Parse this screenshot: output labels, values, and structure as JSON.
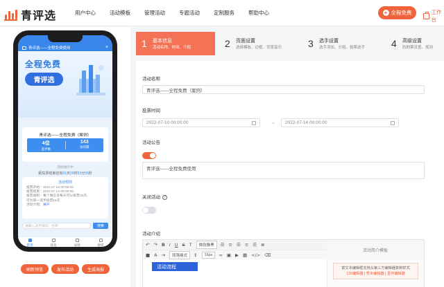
{
  "brand": {
    "name": "青评选",
    "accent": "#f0643c"
  },
  "nav": {
    "items": [
      "用户中心",
      "活动模板",
      "管理活动",
      "专题活动",
      "定制服务",
      "帮助中心"
    ]
  },
  "header": {
    "free_button": "全程免费",
    "workbench": "工作台"
  },
  "phone": {
    "announcement": "青评选——全程免费使用",
    "banner_line1": "全程免费",
    "banner_line2": "青评选",
    "activity_title": "青评选——全程免费（案例）",
    "stats": [
      {
        "value": "4位",
        "label": "选手数"
      },
      {
        "value": "143",
        "label": "访问量"
      }
    ],
    "progress_label": "活动进行中",
    "progress_prefix": "距投票结束还有",
    "countdown": [
      {
        "num": "01",
        "unit": "天"
      },
      {
        "num": "09",
        "unit": "时"
      },
      {
        "num": "53",
        "unit": "分"
      },
      {
        "num": "55",
        "unit": "秒"
      }
    ],
    "rules_title": "活动规则",
    "rules": [
      "投票开始：2022.07.10 00:00:00",
      "投票结束：2022.07.14 00:00:00",
      "投票规则：每个微信号每天可以投票15次,",
      "可为同一选手投票15次"
    ],
    "intro_label": "活动介绍：",
    "intro_more": "展开",
    "search_placeholder": "请输入选手编号、名称",
    "search_button": "搜索",
    "tabs": [
      "首页",
      "排名",
      "详情",
      "搜索"
    ],
    "actions": [
      "刷新预览",
      "发布活动",
      "生成海报"
    ]
  },
  "steps": [
    {
      "num": "1",
      "title": "基本信息",
      "desc": "活动名称、时间、介绍",
      "active": true
    },
    {
      "num": "2",
      "title": "页面设置",
      "desc": "选择模板、边框、背景音乐",
      "active": false
    },
    {
      "num": "3",
      "title": "选手设置",
      "desc": "选手添加、分组、投票选手",
      "active": false
    },
    {
      "num": "4",
      "title": "高级设置",
      "desc": "防刷票设置、规则",
      "active": false
    }
  ],
  "form": {
    "name_label": "活动名称",
    "name_value": "青评选——全程免费（案例）",
    "time_label": "投票时间",
    "start_time": "2022-07-10 00:00:00",
    "end_time": "2022-07-14 00:00:00",
    "range_sep": "~",
    "notice_label": "活动公告",
    "notice_enabled": true,
    "notice_value": "青评选——全程免费使用",
    "close_label": "关闭活动",
    "close_enabled": false,
    "intro_label": "活动介绍",
    "editor": {
      "font_family": "微软雅黑",
      "paragraph": "段落格式",
      "font_size": "16px",
      "flow_title": "活动流程",
      "template_panel_title": "活动简介模板",
      "template_hint": "富文本编辑框支持从第三方编辑器复制样式",
      "template_links": [
        "135编辑器",
        "秀米编辑器",
        "壹伴编辑器"
      ]
    }
  }
}
